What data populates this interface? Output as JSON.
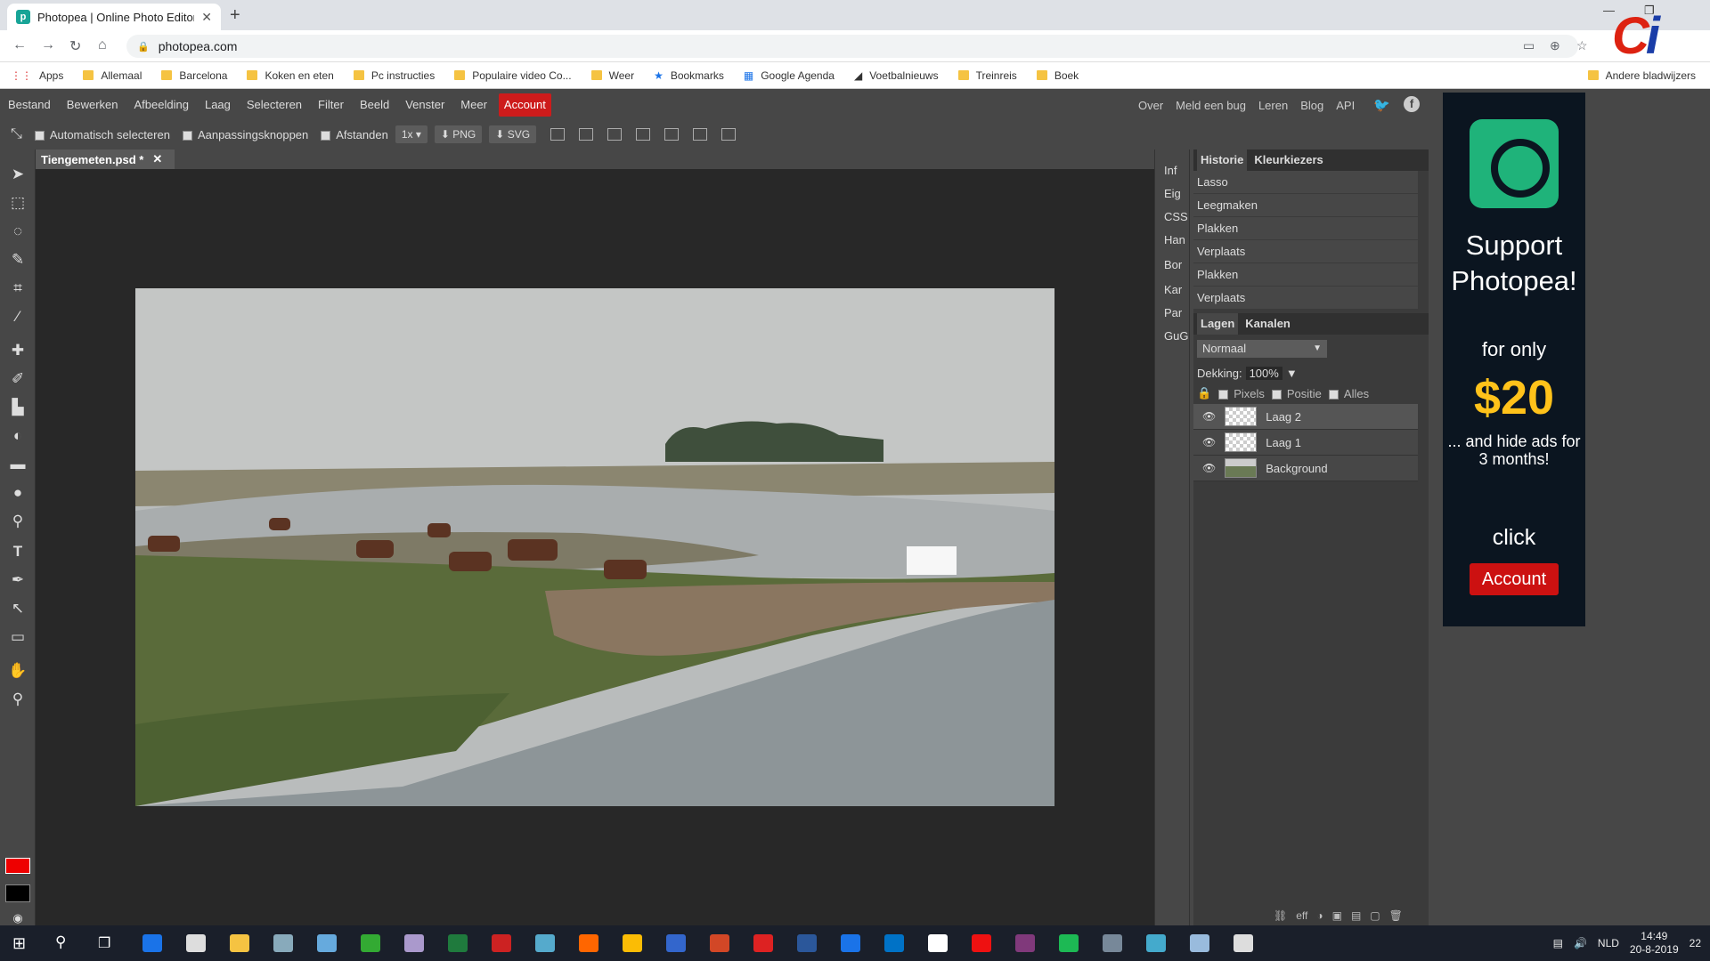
{
  "browser": {
    "tab_title": "Photopea | Online Photo Editor",
    "tab_close": "✕",
    "new_tab": "+",
    "url": "photopea.com",
    "bookmarks": [
      {
        "label": "Apps",
        "type": "apps"
      },
      {
        "label": "Allemaal",
        "type": "folder"
      },
      {
        "label": "Barcelona",
        "type": "folder"
      },
      {
        "label": "Koken en eten",
        "type": "folder"
      },
      {
        "label": "Pc instructies",
        "type": "folder"
      },
      {
        "label": "Populaire video Co...",
        "type": "folder"
      },
      {
        "label": "Weer",
        "type": "folder"
      },
      {
        "label": "Bookmarks",
        "type": "star"
      },
      {
        "label": "Google Agenda",
        "type": "calendar"
      },
      {
        "label": "Voetbalnieuws",
        "type": "link"
      },
      {
        "label": "Treinreis",
        "type": "folder"
      },
      {
        "label": "Boek",
        "type": "folder"
      }
    ],
    "other_bookmarks": "Andere bladwijzers"
  },
  "menu": {
    "items": [
      "Bestand",
      "Bewerken",
      "Afbeelding",
      "Laag",
      "Selecteren",
      "Filter",
      "Beeld",
      "Venster",
      "Meer"
    ],
    "account": "Account",
    "right_items": [
      "Over",
      "Meld een bug",
      "Leren",
      "Blog",
      "API"
    ]
  },
  "options": {
    "auto_select": "Automatisch selecteren",
    "transform_controls": "Aanpassingsknoppen",
    "distances": "Afstanden",
    "zoom": "1x",
    "png": "PNG",
    "svg": "SVG"
  },
  "document": {
    "tab": "Tiengemeten.psd *"
  },
  "side_panel": [
    "Inf",
    "Eig",
    "CSS",
    "Han",
    "Bor",
    "Kar",
    "Par",
    "GuG"
  ],
  "history": {
    "tabs": [
      "Historie",
      "Kleurkiezers"
    ],
    "items": [
      "Lasso",
      "Leegmaken",
      "Plakken",
      "Verplaats",
      "Plakken",
      "Verplaats"
    ]
  },
  "layers": {
    "tabs": [
      "Lagen",
      "Kanalen"
    ],
    "blend_mode": "Normaal",
    "opacity_label": "Dekking:",
    "opacity_value": "100%",
    "lock_options": [
      "Pixels",
      "Positie",
      "Alles"
    ],
    "items": [
      {
        "name": "Laag 2",
        "selected": true
      },
      {
        "name": "Laag 1",
        "selected": false
      },
      {
        "name": "Background",
        "selected": false
      }
    ],
    "footer_fx": "eff"
  },
  "ad": {
    "line1": "Support Photopea!",
    "line2": "for only",
    "price": "$20",
    "line3": "... and hide ads for 3 months!",
    "line4": "click",
    "button": "Account"
  },
  "taskbar": {
    "time": "14:49",
    "date": "20-8-2019",
    "lang": "NLD",
    "notifications": "22"
  },
  "colors": {
    "accent": "#cd1b1b",
    "brand": "#18a497",
    "foreground_color": "#ee0000",
    "background_color": "#000000"
  }
}
